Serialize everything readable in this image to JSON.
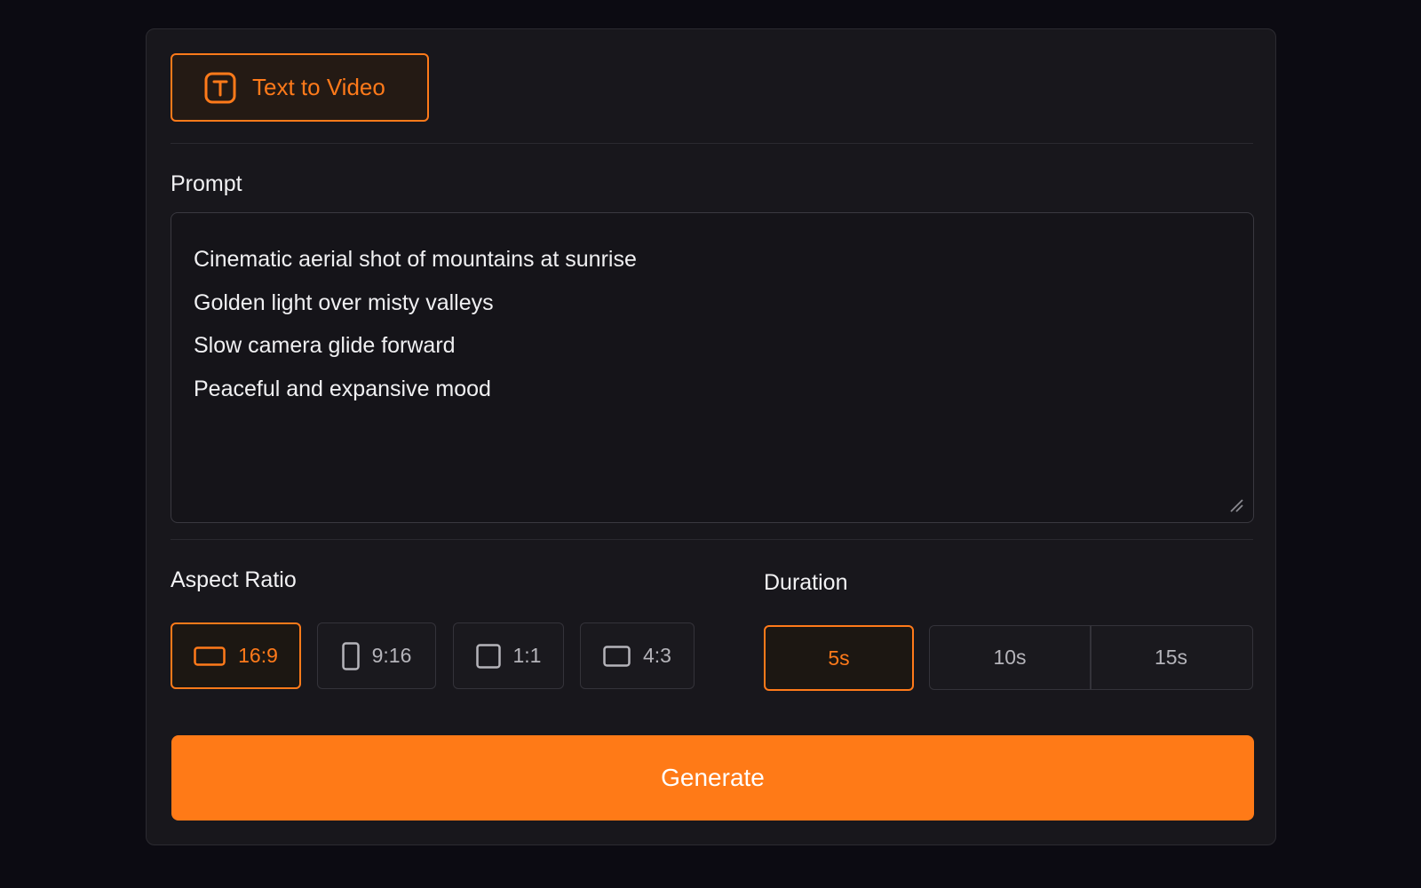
{
  "colors": {
    "accent": "#ff7a1a",
    "background": "#0c0b12",
    "panel": "#18171c"
  },
  "mode": {
    "label": "Text to Video",
    "icon": "text-t-icon"
  },
  "prompt": {
    "label": "Prompt",
    "lines": [
      "Cinematic aerial shot of mountains at sunrise",
      "Golden light over misty valleys",
      "Slow camera glide forward",
      "Peaceful and expansive mood"
    ]
  },
  "aspect_ratio": {
    "label": "Aspect Ratio",
    "selected": "16:9",
    "options": [
      {
        "label": "16:9",
        "icon": "landscape-icon"
      },
      {
        "label": "9:16",
        "icon": "portrait-icon"
      },
      {
        "label": "1:1",
        "icon": "square-icon"
      },
      {
        "label": "4:3",
        "icon": "standard-icon"
      }
    ]
  },
  "duration": {
    "label": "Duration",
    "selected": "5s",
    "options": [
      {
        "label": "5s"
      },
      {
        "label": "10s"
      },
      {
        "label": "15s"
      }
    ]
  },
  "generate": {
    "label": "Generate"
  }
}
